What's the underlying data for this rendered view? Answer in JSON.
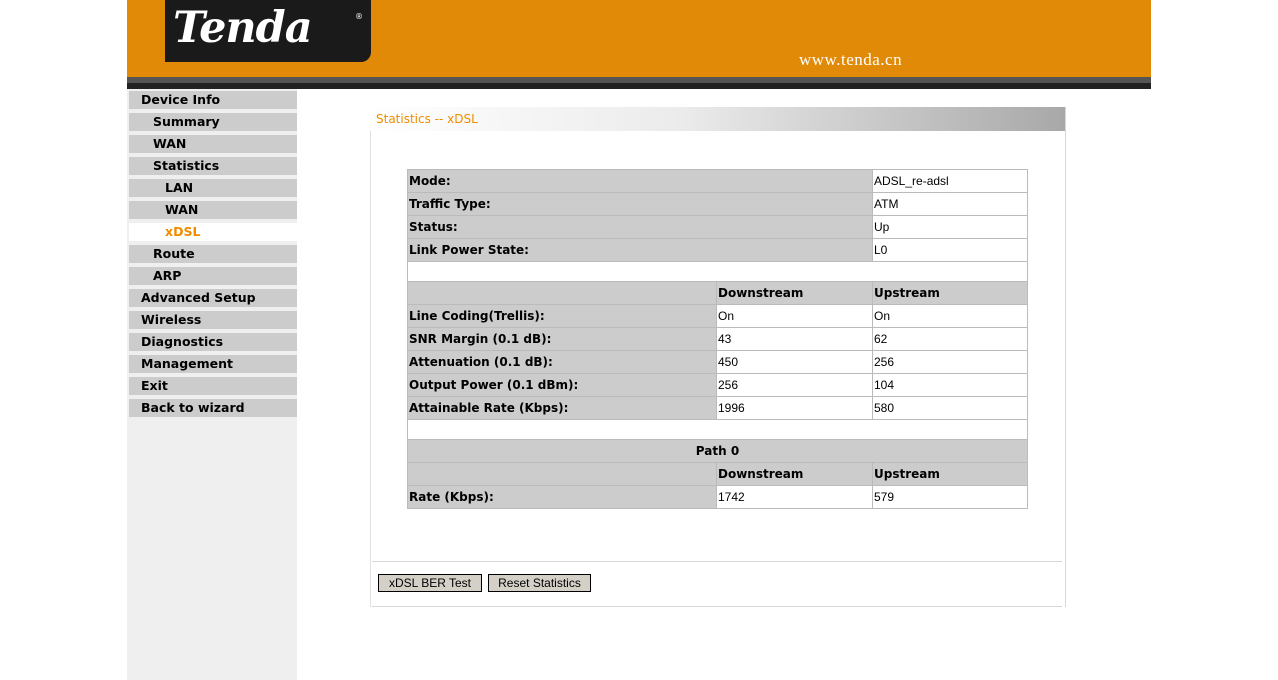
{
  "header": {
    "logo_text": "Tenda",
    "logo_mark": "®",
    "site_url": "www.tenda.cn"
  },
  "sidebar": {
    "items": [
      {
        "label": "Device Info"
      },
      {
        "label": "Summary"
      },
      {
        "label": "WAN"
      },
      {
        "label": "Statistics"
      },
      {
        "label": "LAN"
      },
      {
        "label": "WAN"
      },
      {
        "label": "xDSL"
      },
      {
        "label": "Route"
      },
      {
        "label": "ARP"
      },
      {
        "label": "Advanced Setup"
      },
      {
        "label": "Wireless"
      },
      {
        "label": "Diagnostics"
      },
      {
        "label": "Management"
      },
      {
        "label": "Exit"
      },
      {
        "label": "Back to wizard"
      }
    ],
    "active_color": "#f08c00"
  },
  "panel": {
    "title": "Statistics -- xDSL"
  },
  "stats": {
    "mode_label": "Mode:",
    "mode_value": "ADSL_re-adsl",
    "traffic_label": "Traffic Type:",
    "traffic_value": "ATM",
    "status_label": "Status:",
    "status_value": "Up",
    "lps_label": "Link Power State:",
    "lps_value": "L0",
    "col_down": "Downstream",
    "col_up": "Upstream",
    "rows": [
      {
        "label": "Line Coding(Trellis):",
        "down": "On",
        "up": "On"
      },
      {
        "label": "SNR Margin (0.1 dB):",
        "down": "43",
        "up": "62"
      },
      {
        "label": "Attenuation (0.1 dB):",
        "down": "450",
        "up": "256"
      },
      {
        "label": "Output Power (0.1 dBm):",
        "down": "256",
        "up": "104"
      },
      {
        "label": "Attainable Rate (Kbps):",
        "down": "1996",
        "up": "580"
      }
    ],
    "path_title": "Path 0",
    "rate_label": "Rate (Kbps):",
    "rate_down": "1742",
    "rate_up": "579"
  },
  "buttons": {
    "ber_test": "xDSL BER Test",
    "reset": "Reset Statistics"
  },
  "colors": {
    "header_orange": "#e18a08",
    "accent": "#f08c00"
  }
}
